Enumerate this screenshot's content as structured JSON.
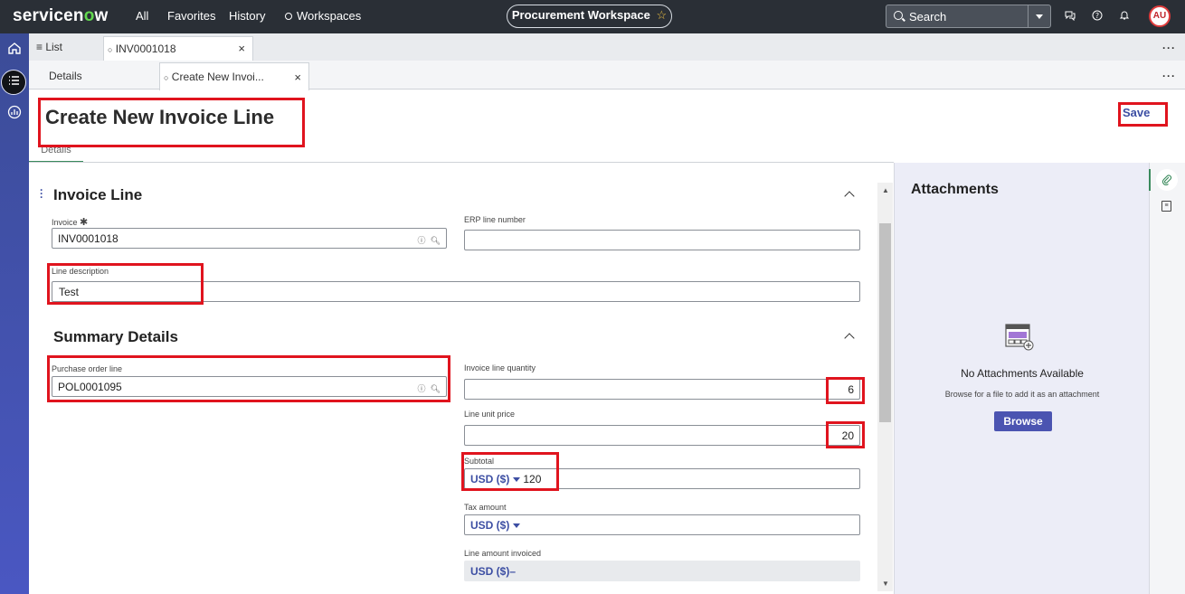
{
  "topbar": {
    "logo": "servicenow",
    "nav": [
      "All",
      "Favorites",
      "History",
      "Workspaces"
    ],
    "workspace_pill": "Procurement Workspace",
    "star_icon": "☆",
    "search_label": "Search",
    "avatar_initials": "AU"
  },
  "tabs": {
    "list_label": "List",
    "record_tab": "INV0001018",
    "close": "×",
    "more": "···"
  },
  "subtabs": {
    "details": "Details",
    "create_tab": "Create New Invoi...",
    "close": "×"
  },
  "header": {
    "title": "Create New Invoice Line",
    "save_label": "Save",
    "details_tab": "Details"
  },
  "invoice_line": {
    "heading": "Invoice Line",
    "invoice_label": "Invoice",
    "invoice_value": "INV0001018",
    "erp_label": "ERP line number",
    "erp_value": "",
    "desc_label": "Line description",
    "desc_value": "Test"
  },
  "summary": {
    "heading": "Summary Details",
    "pol_label": "Purchase order line",
    "pol_value": "POL0001095",
    "qty_label": "Invoice line quantity",
    "qty_value": "6",
    "price_label": "Line unit price",
    "price_value": "20",
    "subtotal_label": "Subtotal",
    "subtotal_currency": "USD ($)",
    "subtotal_value": "120",
    "tax_label": "Tax amount",
    "tax_currency": "USD ($)",
    "amount_label": "Line amount invoiced",
    "amount_value": "USD ($)–"
  },
  "attachments": {
    "title": "Attachments",
    "none": "No Attachments Available",
    "hint": "Browse for a file to add it as an attachment",
    "browse": "Browse"
  },
  "colors": {
    "accent": "#3c4ea3",
    "highlight": "#e0141e",
    "browse_button": "#4b54b1"
  }
}
